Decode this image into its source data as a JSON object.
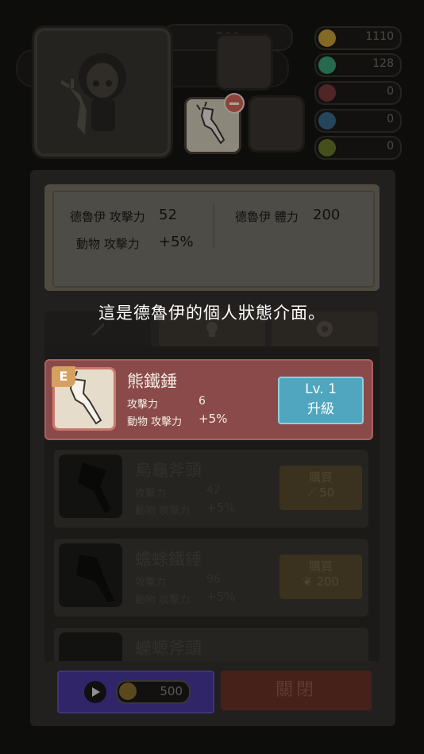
{
  "top": {
    "ghost_value": "200",
    "resources": [
      {
        "name": "gold-coin",
        "value": "1110",
        "color": "#c9a13a"
      },
      {
        "name": "gem",
        "value": "128",
        "color": "#3aa37a"
      },
      {
        "name": "feather",
        "value": "0",
        "color": "#b24a4a"
      },
      {
        "name": "claw",
        "value": "0",
        "color": "#4a8ab2"
      },
      {
        "name": "leaf",
        "value": "0",
        "color": "#8a9a2a"
      }
    ]
  },
  "stats": {
    "atk_label": "德魯伊 攻擊力",
    "atk_value": "52",
    "hp_label": "德魯伊 體力",
    "hp_value": "200",
    "animal_label": "動物 攻擊力",
    "animal_value": "+5%"
  },
  "tutorial_message": "這是德魯伊的個人狀態介面。",
  "items": [
    {
      "grade": "E",
      "name": "熊鐵錘",
      "atk_label": "攻擊力",
      "atk_value": "6",
      "animal_label": "動物 攻擊力",
      "animal_value": "+5%",
      "btn_line1": "Lv. 1",
      "btn_line2": "升級"
    },
    {
      "name": "烏龜斧頭",
      "atk_label": "攻擊力",
      "atk_value": "42",
      "animal_label": "動物 攻擊力",
      "animal_value": "+5%",
      "btn_line1": "購買",
      "btn_line2": "50"
    },
    {
      "name": "蟾蜍鐵錘",
      "atk_label": "攻擊力",
      "atk_value": "96",
      "animal_label": "動物 攻擊力",
      "animal_value": "+5%",
      "btn_line1": "購買",
      "btn_line2": "200"
    },
    {
      "name": "蠑螈斧頭"
    }
  ],
  "bottom": {
    "video_price": "500",
    "close_label": "關閉"
  }
}
